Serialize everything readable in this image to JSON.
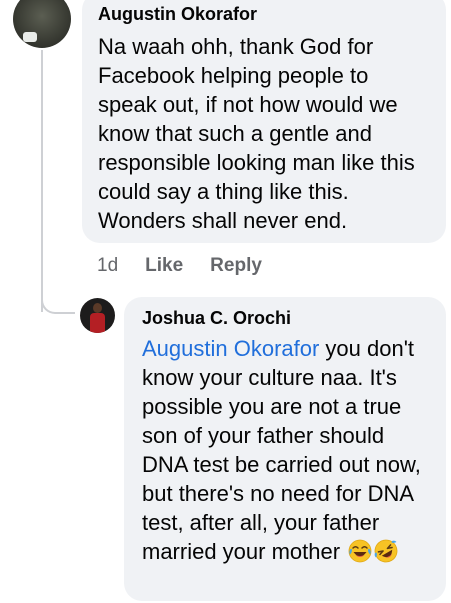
{
  "comments": [
    {
      "author": "Augustin Okorafor",
      "text": "Na waah ohh, thank God for Facebook  helping people to speak out, if not how would we know that such a gentle and responsible looking man like this could say a thing like this. Wonders shall never end.",
      "time": "1d",
      "like_label": "Like",
      "reply_label": "Reply",
      "avatar_icon": "user-avatar"
    }
  ],
  "reply": {
    "author": "Joshua C. Orochi",
    "mention": "Augustin Okorafor",
    "text": " you don't know your culture naa. It's possible you are not a true son of your father should DNA test be carried out now, but there's no need for DNA test, after all, your father married your mother ",
    "emojis": [
      "face-with-tears-of-joy-icon",
      "rolling-on-floor-laughing-icon"
    ],
    "avatar_icon": "user-avatar"
  },
  "colors": {
    "bubble_bg": "#f0f2f5",
    "text": "#050505",
    "secondary_text": "#65676b",
    "mention_link": "#216fdb",
    "thread_line": "#ced0d4"
  }
}
